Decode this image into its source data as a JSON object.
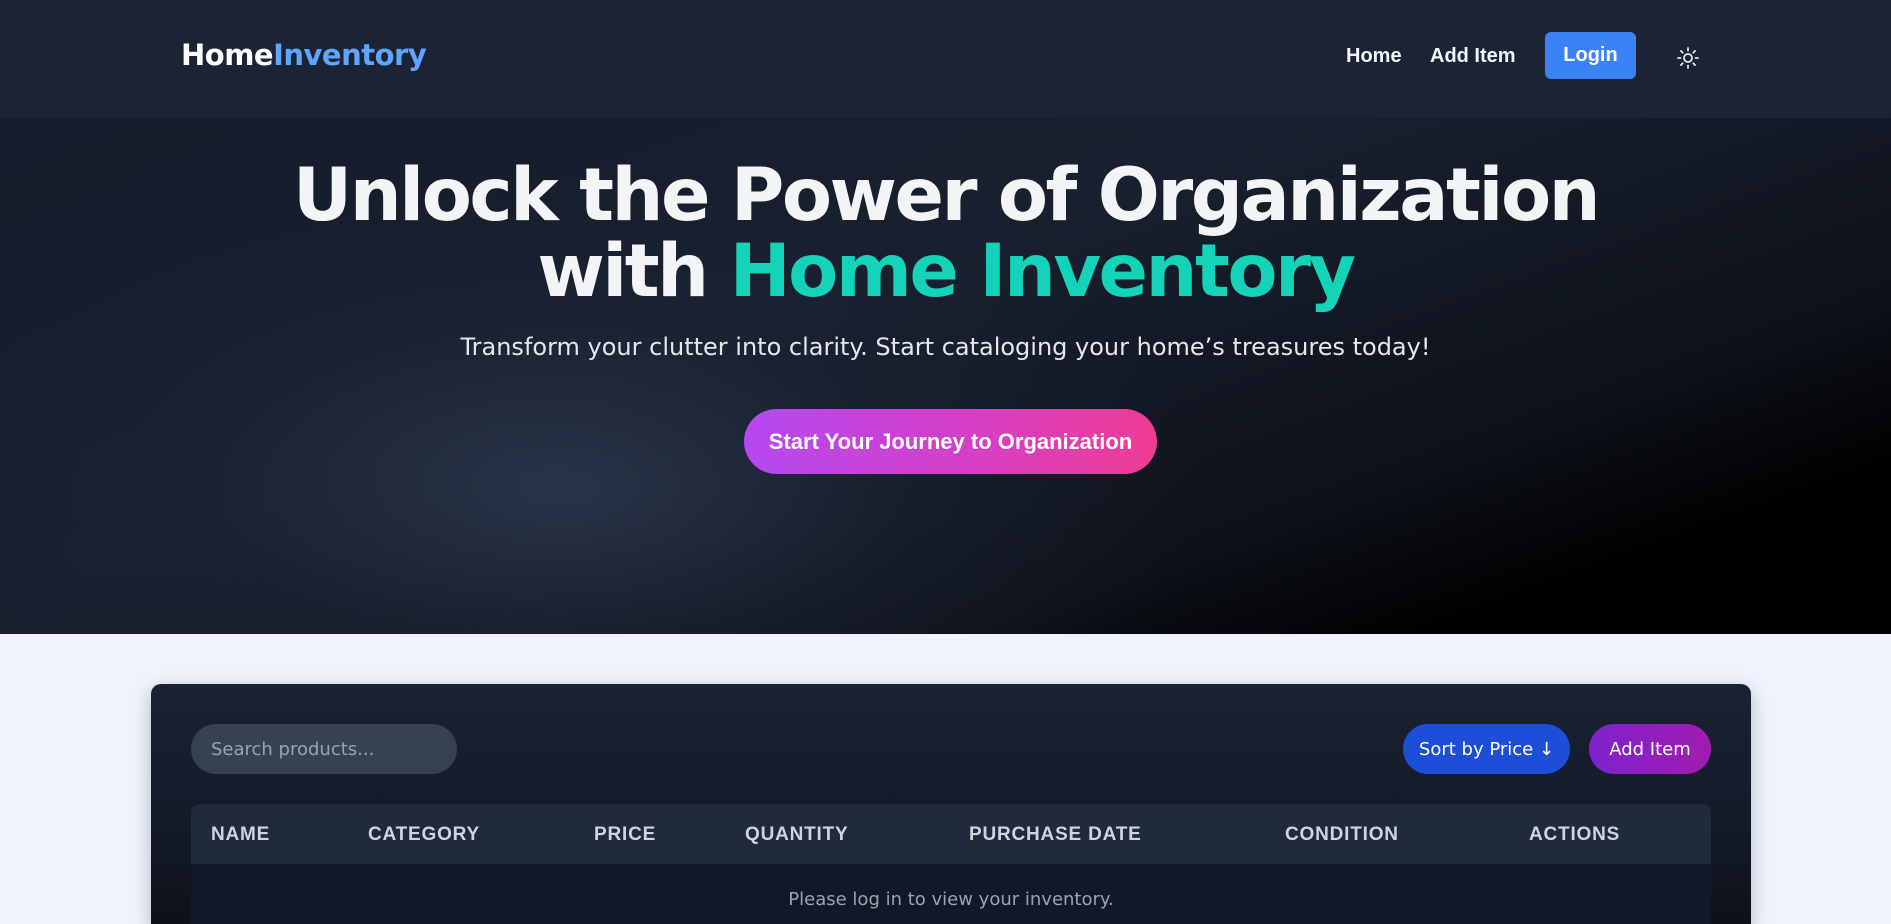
{
  "navbar": {
    "brand_part1": "Home",
    "brand_part2": "Inventory",
    "links": {
      "home": "Home",
      "add_item": "Add Item"
    },
    "login_label": "Login",
    "theme_icon": "sun-icon"
  },
  "hero": {
    "title_line1": "Unlock the Power of Organization",
    "title_line2_prefix": "with ",
    "title_line2_accent": "Home Inventory",
    "subtitle": "Transform your clutter into clarity. Start cataloging your home’s treasures today!",
    "cta_label": "Start Your Journey to Organization"
  },
  "inventory": {
    "search_placeholder": "Search products...",
    "sort_label": "Sort by Price ↓",
    "add_label": "Add Item",
    "columns": {
      "name": "NAME",
      "category": "CATEGORY",
      "price": "PRICE",
      "quantity": "QUANTITY",
      "purchase_date": "PURCHASE DATE",
      "condition": "CONDITION",
      "actions": "ACTIONS"
    },
    "empty_message": "Please log in to view your inventory."
  },
  "colors": {
    "accent_blue": "#3b82f6",
    "accent_teal": "#14d3b8",
    "brand_blue": "#60a5fa",
    "cta_start": "#b449f1",
    "cta_end": "#ef3b93"
  }
}
